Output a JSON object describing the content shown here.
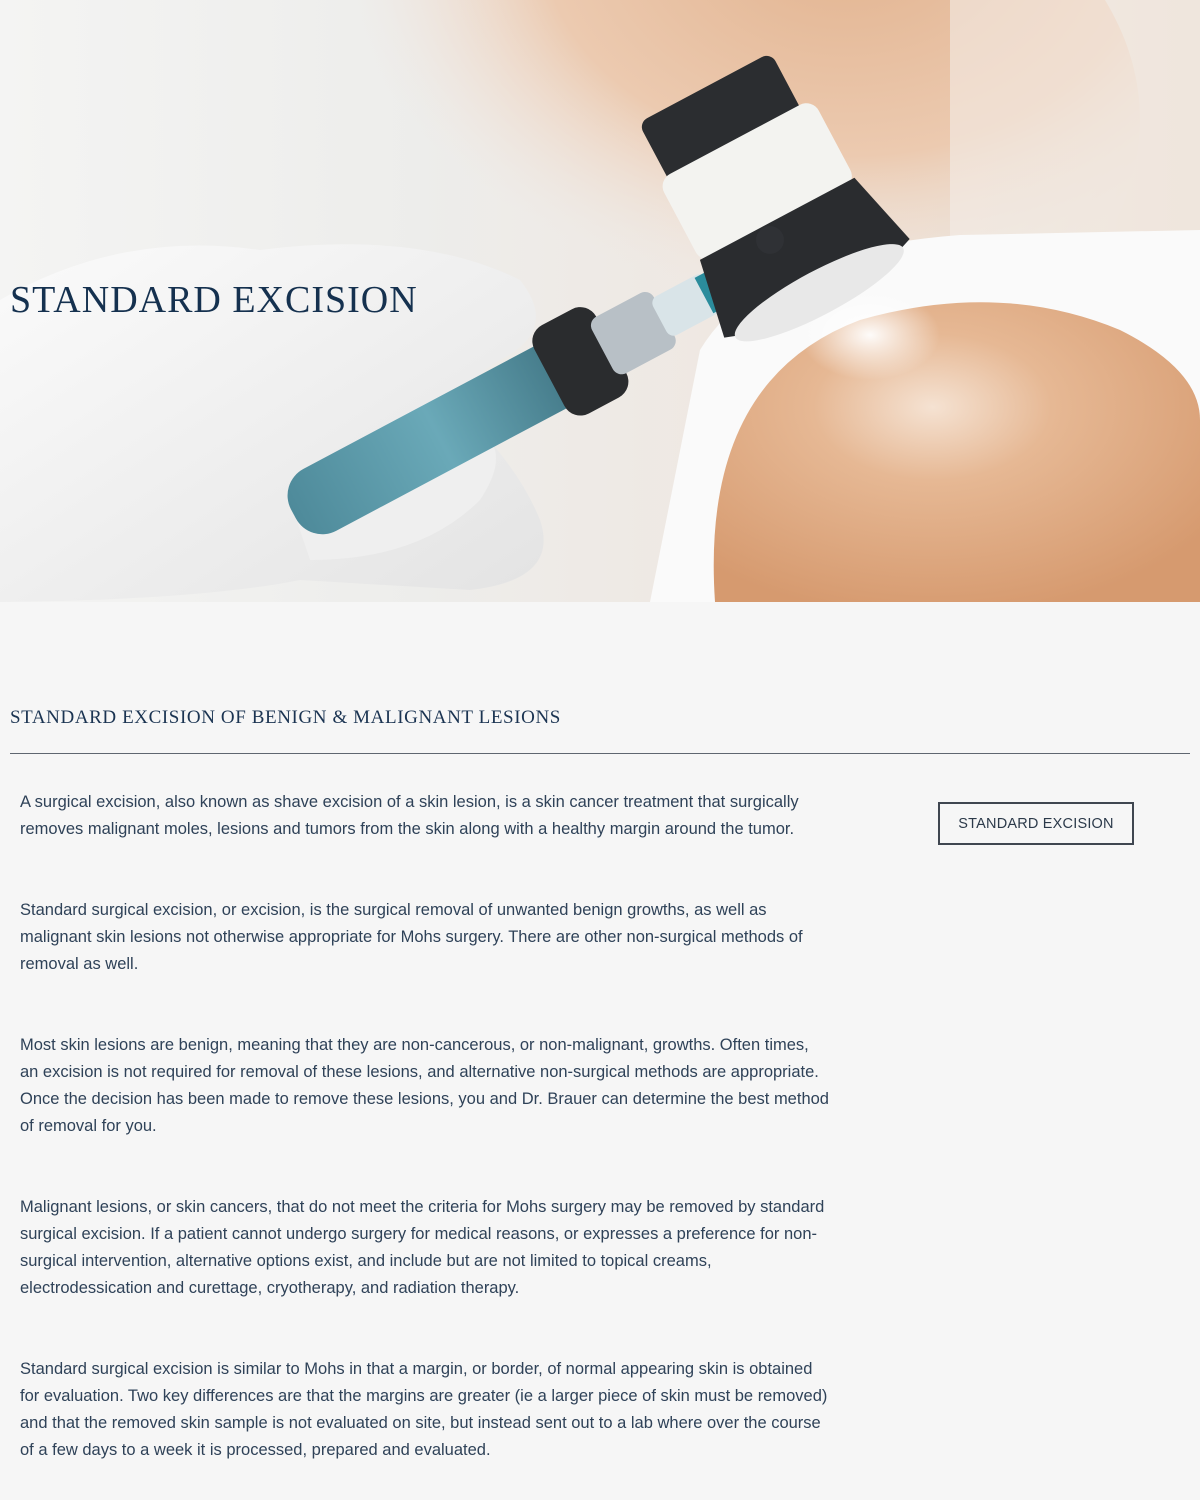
{
  "hero": {
    "title": "STANDARD EXCISION",
    "image_alt": "dermatoscope-skin-exam-photo"
  },
  "main": {
    "heading": "STANDARD EXCISION OF BENIGN & MALIGNANT LESIONS",
    "paragraphs": [
      "A surgical excision, also known as shave excision of a skin lesion, is a skin cancer treatment that surgically removes malignant moles, lesions and tumors from the skin along with a healthy margin around the tumor.",
      "Standard surgical excision, or excision, is the surgical removal of unwanted benign growths, as well as malignant skin lesions not otherwise appropriate for Mohs surgery.  There are other non-surgical methods of removal as well.",
      "Most skin lesions are benign, meaning that they are non-cancerous, or non-malignant, growths.  Often times, an excision is not required for removal of these lesions, and alternative non-surgical methods are appropriate.  Once the decision has been made to remove these lesions, you and Dr. Brauer can determine the best method of removal for you.",
      "Malignant lesions, or skin cancers, that do not meet the criteria for Mohs surgery may be removed by standard surgical excision.  If a patient cannot undergo surgery for medical reasons, or expresses a preference for non-surgical intervention, alternative options exist, and include but are not limited to topical creams, electrodessication and curettage, cryotherapy, and radiation therapy.",
      "Standard surgical excision is similar to Mohs in that a margin, or border, of normal appearing skin is obtained for evaluation.  Two key differences are that the margins are greater (ie a larger piece of skin must be removed) and that the removed skin sample is not evaluated on site, but instead sent out to a lab where over the course of a few days to a week it is processed, prepared and evaluated."
    ],
    "side_button_label": "STANDARD EXCISION"
  },
  "colors": {
    "page_bg": "#f6f6f6",
    "heading_navy": "#15314f",
    "body_text": "#2f4258"
  }
}
